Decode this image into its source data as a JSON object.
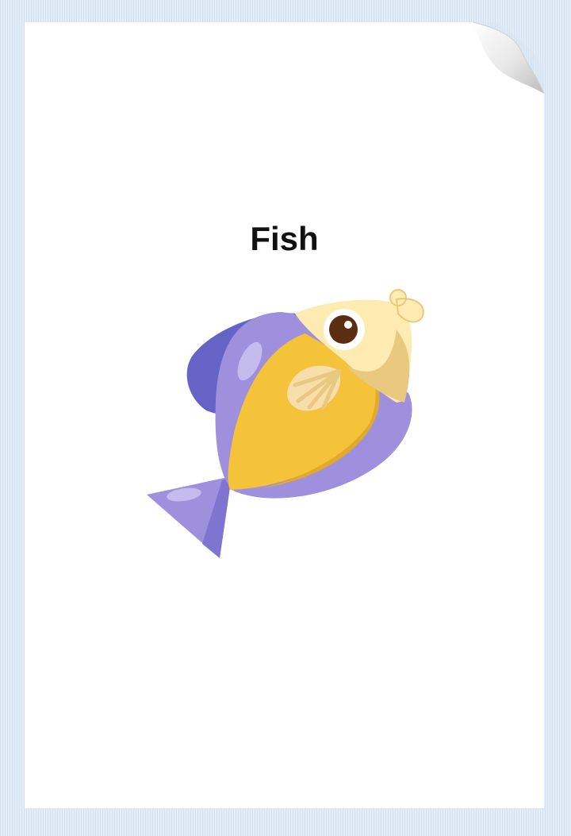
{
  "card": {
    "title": "Fish",
    "illustration": "fish-illustration",
    "page_corner": "page-curl"
  },
  "colors": {
    "background": "#dce9f6",
    "card": "#ffffff",
    "title": "#111111",
    "fish_body_purple": "#9e90dd",
    "fish_dorsal_fin": "#6663c6",
    "fish_belly_yellow": "#f4c33a",
    "fish_head": "#fdebb2",
    "fish_eye": "#5b2e12"
  }
}
